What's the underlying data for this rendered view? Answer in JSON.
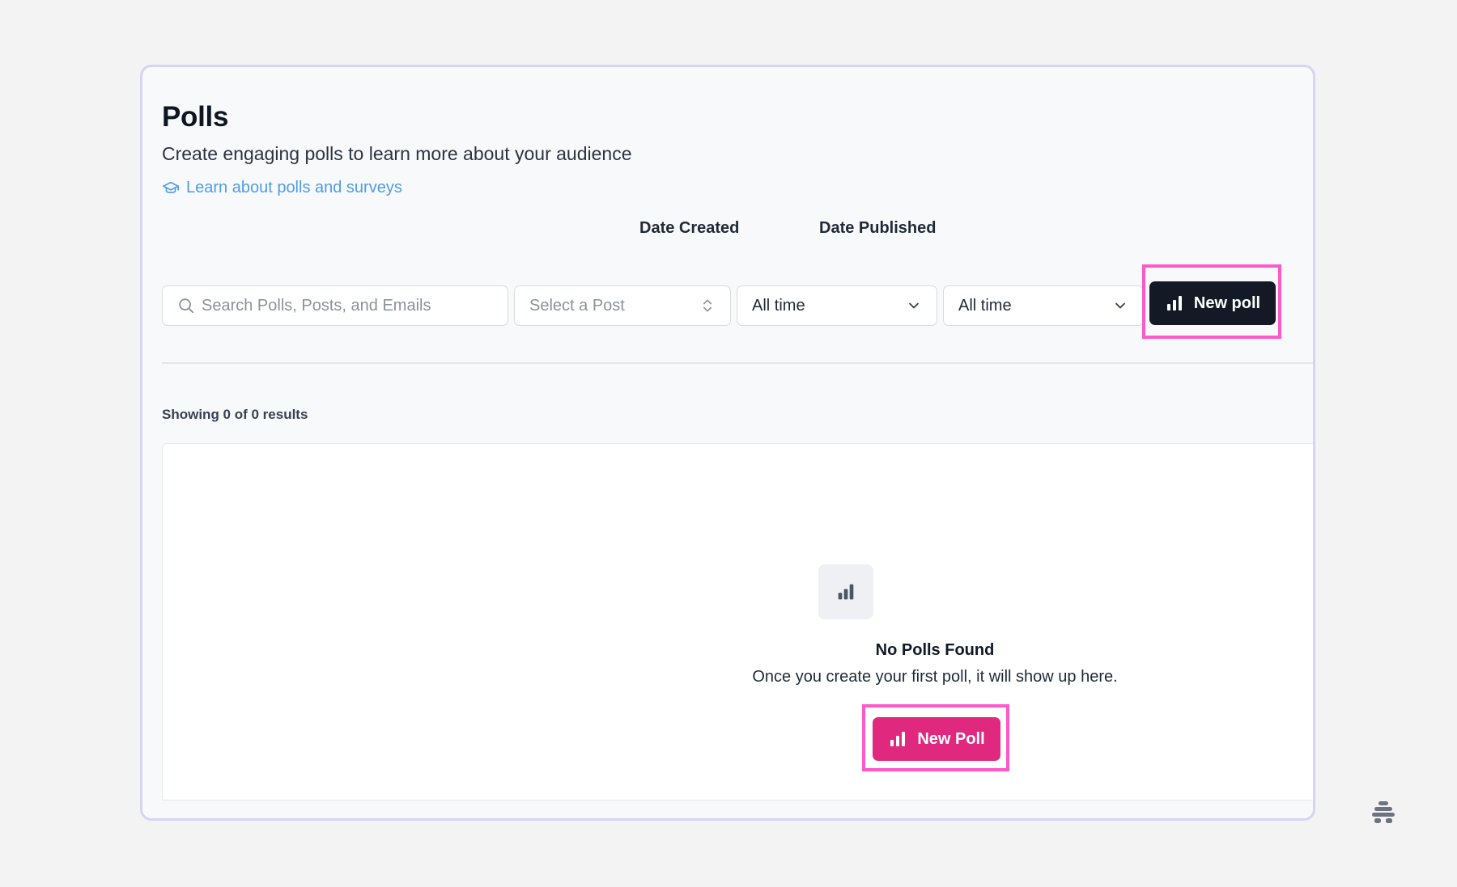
{
  "header": {
    "title": "Polls",
    "subtitle": "Create engaging polls to learn more about your audience",
    "learn_link": "Learn about polls and surveys"
  },
  "filters": {
    "search_placeholder": "Search Polls, Posts, and Emails",
    "post_select_placeholder": "Select a Post",
    "date_created_label": "Date Created",
    "date_created_value": "All time",
    "date_published_label": "Date Published",
    "date_published_value": "All time"
  },
  "toolbar": {
    "new_poll_label": "New poll"
  },
  "results": {
    "summary": "Showing 0 of 0 results"
  },
  "empty_state": {
    "title": "No Polls Found",
    "message": "Once you create your first poll, it will show up here.",
    "button_label": "New Poll"
  },
  "colors": {
    "accent_pink": "#e0287e",
    "dark_button": "#131a26",
    "link_blue": "#4f9ce6",
    "highlight": "#ff58c8"
  }
}
